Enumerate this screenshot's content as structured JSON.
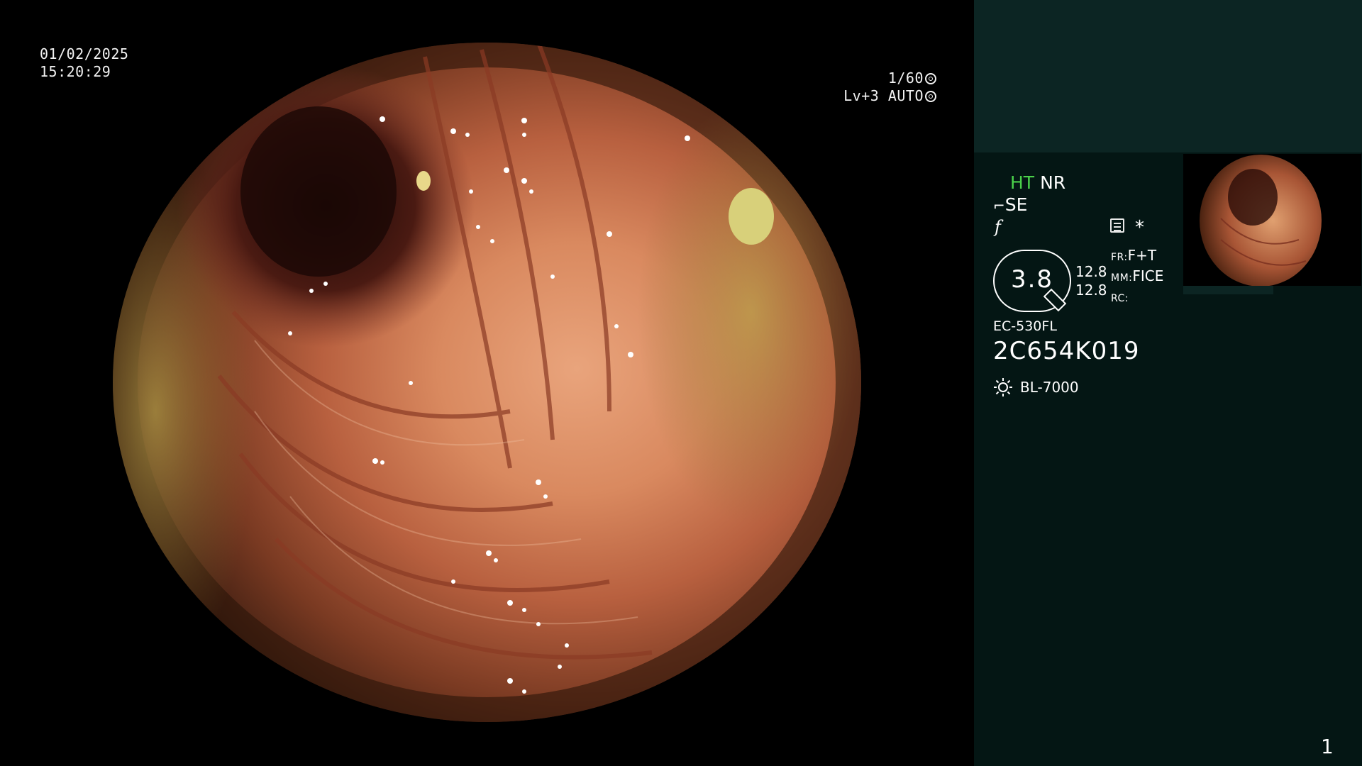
{
  "overlay": {
    "date": "01/02/2025",
    "time": "15:20:29",
    "shutter": "1/60",
    "shutter_icon": "aperture-icon",
    "brightness": "Lv+3",
    "iris_mode": "AUTO",
    "iris_icon": "iris-icon"
  },
  "panel": {
    "mode_ht": "HT",
    "mode_nr": "NR",
    "se_label": "SE",
    "se_icon": "pen-tip-icon",
    "f_label": "f",
    "document_icon": "document-icon",
    "asterisk": "*",
    "zoom_value": "3.8",
    "param_value_1": "12.8",
    "param_value_2": "12.8",
    "fr_label": "FR:",
    "fr_value": "F+T",
    "mm_label": "MM:",
    "mm_value": "FICE",
    "rc_label": "RC:",
    "rc_value": "",
    "scope_model": "EC-530FL",
    "scope_serial": "2C654K019",
    "light_icon": "sun-icon",
    "light_source": "BL-7000",
    "page_number": "1"
  },
  "colors": {
    "ht_green": "#4ad14a",
    "panel_bg": "#041614",
    "panel_top_bg": "#0c2523"
  }
}
